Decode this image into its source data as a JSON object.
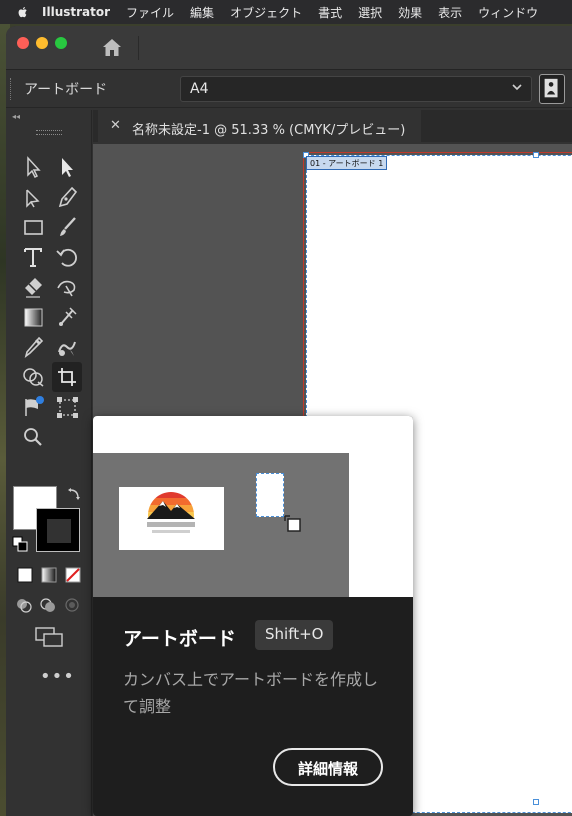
{
  "menubar": {
    "app_name": "Illustrator",
    "items": [
      "ファイル",
      "編集",
      "オブジェクト",
      "書式",
      "選択",
      "効果",
      "表示",
      "ウィンドウ"
    ]
  },
  "control_bar": {
    "label": "アートボード",
    "preset_value": "A4"
  },
  "document": {
    "tab_title": "名称未設定-1 @ 51.33 % (CMYK/プレビュー)",
    "close_glyph": "✕",
    "artboard_name": "01 - アートボード 1"
  },
  "toolbar": {
    "tools": [
      "selection-tool",
      "direct-selection-tool",
      "group-selection-tool",
      "pen-tool",
      "rectangle-tool",
      "paintbrush-tool",
      "type-tool",
      "rotate-tool",
      "eraser-tool",
      "warp-tool",
      "gradient-tool",
      "mesh-tool",
      "eyedropper-tool",
      "blend-tool",
      "shape-builder-tool",
      "artboard-tool",
      "live-paint-tool",
      "free-transform-tool",
      "zoom-tool"
    ],
    "active_tool": "artboard-tool",
    "more_glyph": "•••"
  },
  "tooltip": {
    "title": "アートボード",
    "shortcut": "Shift+O",
    "description": "カンバス上でアートボードを作成して調整",
    "more_button": "詳細情報"
  },
  "colors": {
    "accent_blue": "#4a90d9",
    "bleed_red": "#c0392b",
    "panel_bg": "#323232",
    "tooltip_bg": "#1e1e1e"
  }
}
